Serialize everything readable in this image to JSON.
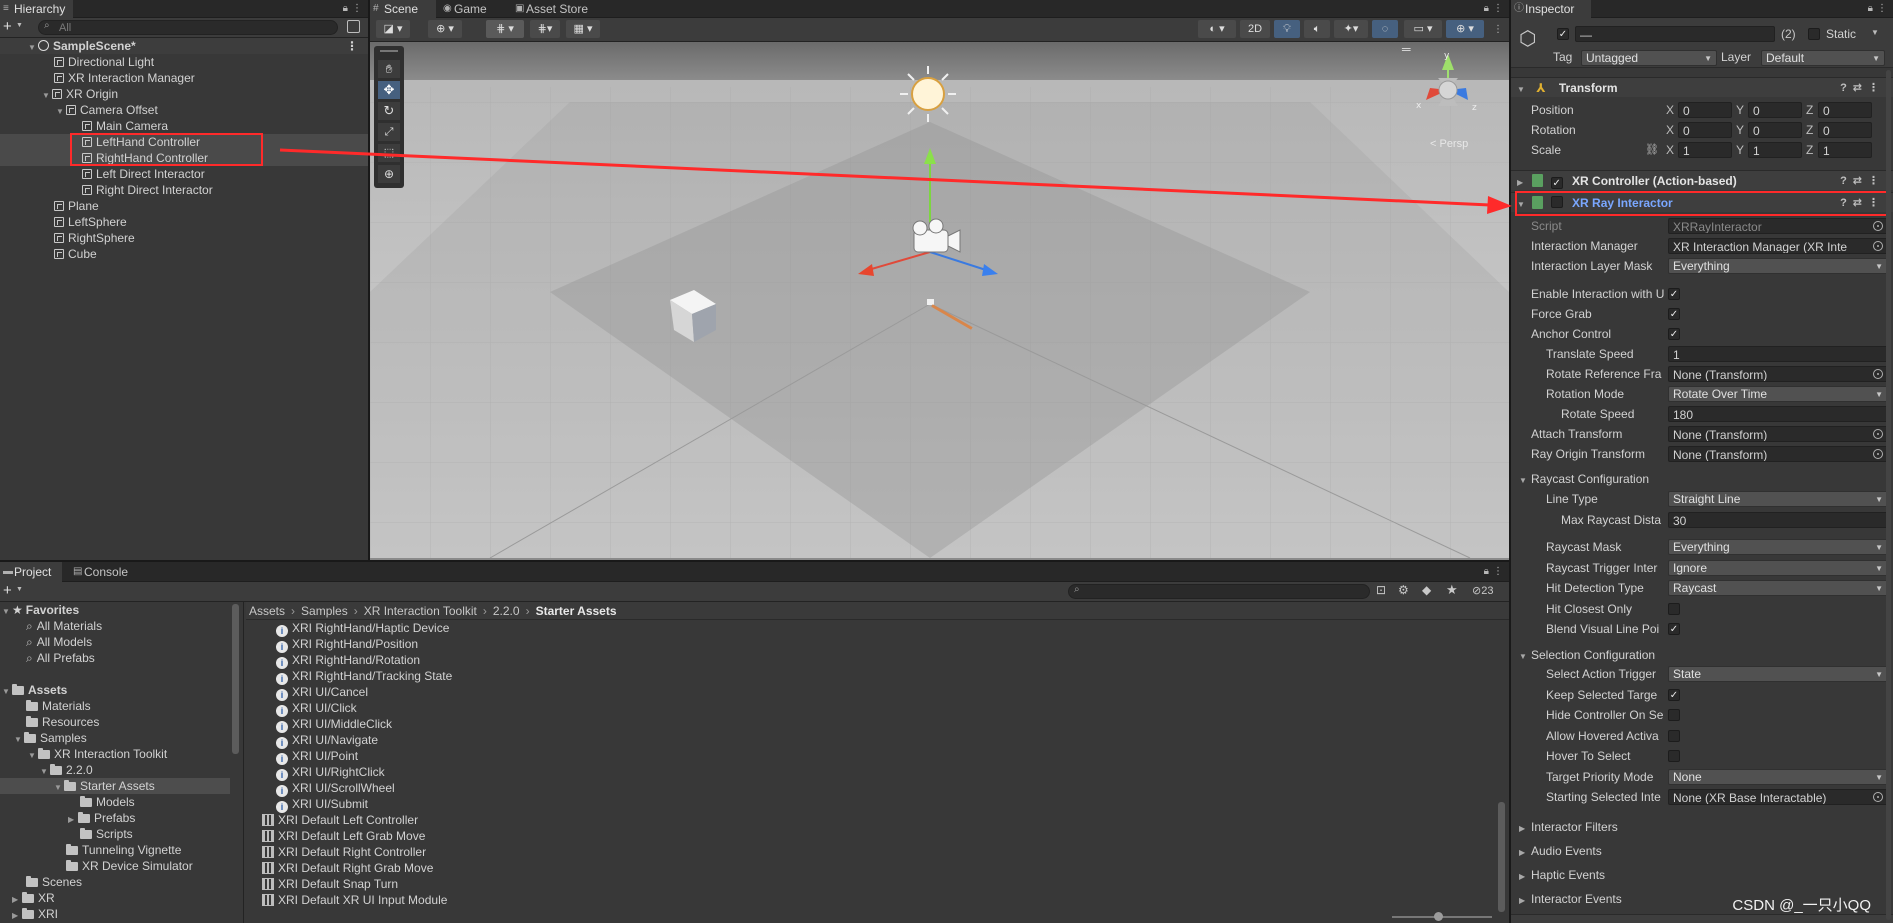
{
  "hierarchy": {
    "tab": "Hierarchy",
    "search_placeholder": "All",
    "scene": "SampleScene*",
    "items": [
      {
        "label": "Directional Light"
      },
      {
        "label": "XR Interaction Manager"
      },
      {
        "label": "XR Origin"
      },
      {
        "label": "Camera Offset"
      },
      {
        "label": "Main Camera"
      },
      {
        "label": "LeftHand Controller"
      },
      {
        "label": "RightHand Controller"
      },
      {
        "label": "Left Direct Interactor"
      },
      {
        "label": "Right Direct Interactor"
      },
      {
        "label": "Plane"
      },
      {
        "label": "LeftSphere"
      },
      {
        "label": "RightSphere"
      },
      {
        "label": "Cube"
      }
    ]
  },
  "scene": {
    "tabs": [
      "Scene",
      "Game",
      "Asset Store"
    ],
    "toolbar_2d": "2D",
    "persp_label": "< Persp",
    "gizmo_axes": [
      "y",
      "x",
      "z"
    ]
  },
  "project": {
    "tabs": [
      "Project",
      "Console"
    ],
    "badge": "23",
    "breadcrumb": [
      "Assets",
      "Samples",
      "XR Interaction Toolkit",
      "2.2.0",
      "Starter Assets"
    ],
    "favorites": {
      "label": "Favorites",
      "items": [
        "All Materials",
        "All Models",
        "All Prefabs"
      ]
    },
    "tree": [
      {
        "label": "Assets"
      },
      {
        "label": "Materials"
      },
      {
        "label": "Resources"
      },
      {
        "label": "Samples"
      },
      {
        "label": "XR Interaction Toolkit"
      },
      {
        "label": "2.2.0"
      },
      {
        "label": "Starter Assets"
      },
      {
        "label": "Models"
      },
      {
        "label": "Prefabs"
      },
      {
        "label": "Scripts"
      },
      {
        "label": "Tunneling Vignette"
      },
      {
        "label": "XR Device Simulator"
      },
      {
        "label": "Scenes"
      },
      {
        "label": "XR"
      },
      {
        "label": "XRI"
      }
    ],
    "files": [
      {
        "label": "XRI RightHand/Haptic Device",
        "kind": "action"
      },
      {
        "label": "XRI RightHand/Position",
        "kind": "action"
      },
      {
        "label": "XRI RightHand/Rotation",
        "kind": "action"
      },
      {
        "label": "XRI RightHand/Tracking State",
        "kind": "action"
      },
      {
        "label": "XRI UI/Cancel",
        "kind": "action"
      },
      {
        "label": "XRI UI/Click",
        "kind": "action"
      },
      {
        "label": "XRI UI/MiddleClick",
        "kind": "action"
      },
      {
        "label": "XRI UI/Navigate",
        "kind": "action"
      },
      {
        "label": "XRI UI/Point",
        "kind": "action"
      },
      {
        "label": "XRI UI/RightClick",
        "kind": "action"
      },
      {
        "label": "XRI UI/ScrollWheel",
        "kind": "action"
      },
      {
        "label": "XRI UI/Submit",
        "kind": "action"
      },
      {
        "label": "XRI Default Left Controller",
        "kind": "preset"
      },
      {
        "label": "XRI Default Left Grab Move",
        "kind": "preset"
      },
      {
        "label": "XRI Default Right Controller",
        "kind": "preset"
      },
      {
        "label": "XRI Default Right Grab Move",
        "kind": "preset"
      },
      {
        "label": "XRI Default Snap Turn",
        "kind": "preset"
      },
      {
        "label": "XRI Default XR UI Input Module",
        "kind": "preset"
      }
    ]
  },
  "inspector": {
    "tab": "Inspector",
    "name_field": "—",
    "multi_count": "(2)",
    "static_label": "Static",
    "tag_label": "Tag",
    "tag_value": "Untagged",
    "layer_label": "Layer",
    "layer_value": "Default",
    "transform": {
      "title": "Transform",
      "rows": [
        {
          "label": "Position",
          "x": "0",
          "y": "0",
          "z": "0"
        },
        {
          "label": "Rotation",
          "x": "0",
          "y": "0",
          "z": "0"
        },
        {
          "label": "Scale",
          "x": "1",
          "y": "1",
          "z": "1"
        }
      ]
    },
    "xr_controller_title": "XR Controller (Action-based)",
    "ray_title": "XR Ray Interactor",
    "ray_props": [
      {
        "label": "Script",
        "value": "XRRayInteractor",
        "type": "object",
        "dim": true
      },
      {
        "label": "Interaction Manager",
        "value": "XR Interaction Manager (XR Inte",
        "type": "object"
      },
      {
        "label": "Interaction Layer Mask",
        "value": "Everything",
        "type": "dropdown"
      },
      {
        "label": "Enable Interaction with U",
        "value": "✓",
        "type": "check"
      },
      {
        "label": "Force Grab",
        "value": "✓",
        "type": "check"
      },
      {
        "label": "Anchor Control",
        "value": "✓",
        "type": "check"
      },
      {
        "label": "Translate Speed",
        "value": "1",
        "type": "text",
        "indent": 1
      },
      {
        "label": "Rotate Reference Fra",
        "value": "None (Transform)",
        "type": "object",
        "indent": 1
      },
      {
        "label": "Rotation Mode",
        "value": "Rotate Over Time",
        "type": "dropdown",
        "indent": 1
      },
      {
        "label": "Rotate Speed",
        "value": "180",
        "type": "text",
        "indent": 2
      },
      {
        "label": "Attach Transform",
        "value": "None (Transform)",
        "type": "object"
      },
      {
        "label": "Ray Origin Transform",
        "value": "None (Transform)",
        "type": "object"
      }
    ],
    "raycast": {
      "title": "Raycast Configuration",
      "props_a": [
        {
          "label": "Line Type",
          "value": "Straight Line",
          "type": "dropdown",
          "indent": 1
        },
        {
          "label": "Max Raycast Dista",
          "value": "30",
          "type": "text",
          "indent": 2
        }
      ],
      "props_b": [
        {
          "label": "Raycast Mask",
          "value": "Everything",
          "type": "dropdown",
          "indent": 1
        },
        {
          "label": "Raycast Trigger Inter",
          "value": "Ignore",
          "type": "dropdown",
          "indent": 1
        },
        {
          "label": "Hit Detection Type",
          "value": "Raycast",
          "type": "dropdown",
          "indent": 1
        },
        {
          "label": "Hit Closest Only",
          "value": "",
          "type": "check",
          "indent": 1
        },
        {
          "label": "Blend Visual Line Poi",
          "value": "✓",
          "type": "check",
          "indent": 1
        }
      ]
    },
    "selection": {
      "title": "Selection Configuration",
      "props": [
        {
          "label": "Select Action Trigger",
          "value": "State",
          "type": "dropdown",
          "indent": 1
        },
        {
          "label": "Keep Selected Targe",
          "value": "✓",
          "type": "check",
          "indent": 1
        },
        {
          "label": "Hide Controller On Se",
          "value": "",
          "type": "check",
          "indent": 1
        },
        {
          "label": "Allow Hovered Activa",
          "value": "",
          "type": "check",
          "indent": 1
        },
        {
          "label": "Hover To Select",
          "value": "",
          "type": "check",
          "indent": 1
        },
        {
          "label": "Target Priority Mode",
          "value": "None",
          "type": "dropdown",
          "indent": 1
        },
        {
          "label": "Starting Selected Inte",
          "value": "None (XR Base Interactable)",
          "type": "object",
          "indent": 1
        }
      ]
    },
    "collapsed_sections": [
      "Interactor Filters",
      "Audio Events",
      "Haptic Events",
      "Interactor Events"
    ]
  },
  "watermark": "CSDN @_一只小QQ",
  "colors": {
    "annotation_red": "#ff2a2a",
    "component_link_blue": "#7aa7ff",
    "sky": "#7d7d7d"
  }
}
